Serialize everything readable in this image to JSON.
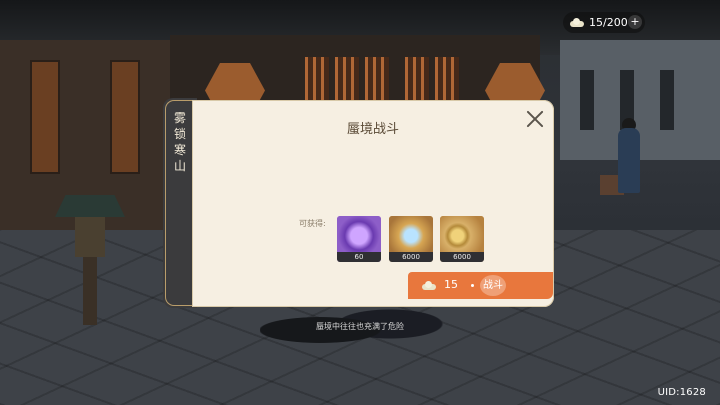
{
  "hud": {
    "stamina": "15/200",
    "stamina_plus": "+",
    "uid": "UID:1628"
  },
  "dialog": {
    "side_title": [
      "雾",
      "锁",
      "寒",
      "山"
    ],
    "title": "蜃境战斗",
    "reward_label": "可获得:",
    "rewards": [
      {
        "icon": "purple-vortex-orb-icon",
        "quantity": "60"
      },
      {
        "icon": "crystal-mountain-icon",
        "quantity": "6000"
      },
      {
        "icon": "gold-coins-icon",
        "quantity": "6000"
      }
    ],
    "battle_button": {
      "cost": "15",
      "label": "战斗"
    },
    "colors": {
      "panel": "#f6efe2",
      "button": "#e8773d",
      "tab": "#3b3b3d"
    }
  },
  "hint": "蜃境中往往也充满了危险"
}
